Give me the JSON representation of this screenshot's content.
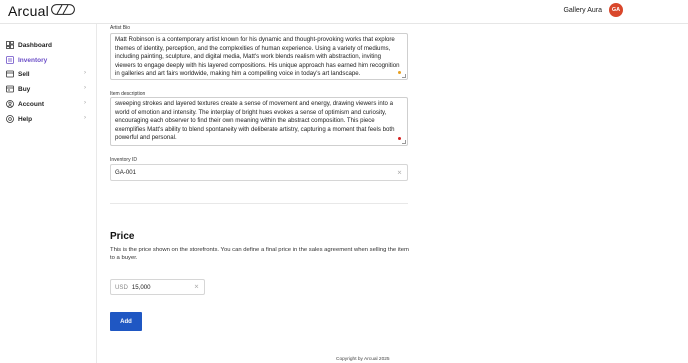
{
  "header": {
    "logo_text": "Arcual",
    "user_name": "Gallery Aura",
    "avatar_initials": "GA",
    "avatar_color": "#d9472b"
  },
  "sidebar": {
    "items": [
      {
        "label": "Dashboard",
        "icon": "dashboard-icon",
        "active": false,
        "has_chevron": false
      },
      {
        "label": "Inventory",
        "icon": "inventory-icon",
        "active": true,
        "has_chevron": false
      },
      {
        "label": "Sell",
        "icon": "sell-icon",
        "active": false,
        "has_chevron": true
      },
      {
        "label": "Buy",
        "icon": "buy-icon",
        "active": false,
        "has_chevron": true
      },
      {
        "label": "Account",
        "icon": "account-icon",
        "active": false,
        "has_chevron": true
      },
      {
        "label": "Help",
        "icon": "help-icon",
        "active": false,
        "has_chevron": true
      }
    ],
    "active_color": "#6b4ec7"
  },
  "form": {
    "artist_bio": {
      "label": "Artist Bio",
      "lines": [
        "Matt Robinson is a contemporary artist known for his dynamic and thought-provoking works that explore",
        "themes of identity, perception, and the complexities of human experience. Using a variety of mediums,",
        "including painting, sculpture, and digital media, Matt's work blends realism with abstraction, inviting",
        "viewers to engage deeply with his layered compositions. His unique approach has earned him recognition",
        "in galleries and art fairs worldwide, making him a compelling voice in today's art landscape."
      ]
    },
    "item_description": {
      "label": "Item description",
      "lines": [
        "sweeping strokes and layered textures create a sense of movement and energy, drawing viewers into a",
        "world of emotion and intensity. The interplay of bright hues evokes a sense of optimism and curiosity,",
        "encouraging each observer to find their own meaning within the abstract composition. This piece",
        "exemplifies Matt's ability to blend spontaneity with deliberate artistry, capturing a moment that feels both",
        "powerful and personal."
      ]
    },
    "inventory_id": {
      "label": "Inventory ID",
      "value": "GA-001"
    }
  },
  "price": {
    "title": "Price",
    "description": "This is the price shown on the storefronts. You can define a final price in the sales agreement when selling the item to a buyer.",
    "currency": "USD",
    "value": "15,000"
  },
  "actions": {
    "add_label": "Add",
    "add_color": "#1f57c3"
  },
  "footer": {
    "text": "Copyright by Arcual 2025"
  }
}
